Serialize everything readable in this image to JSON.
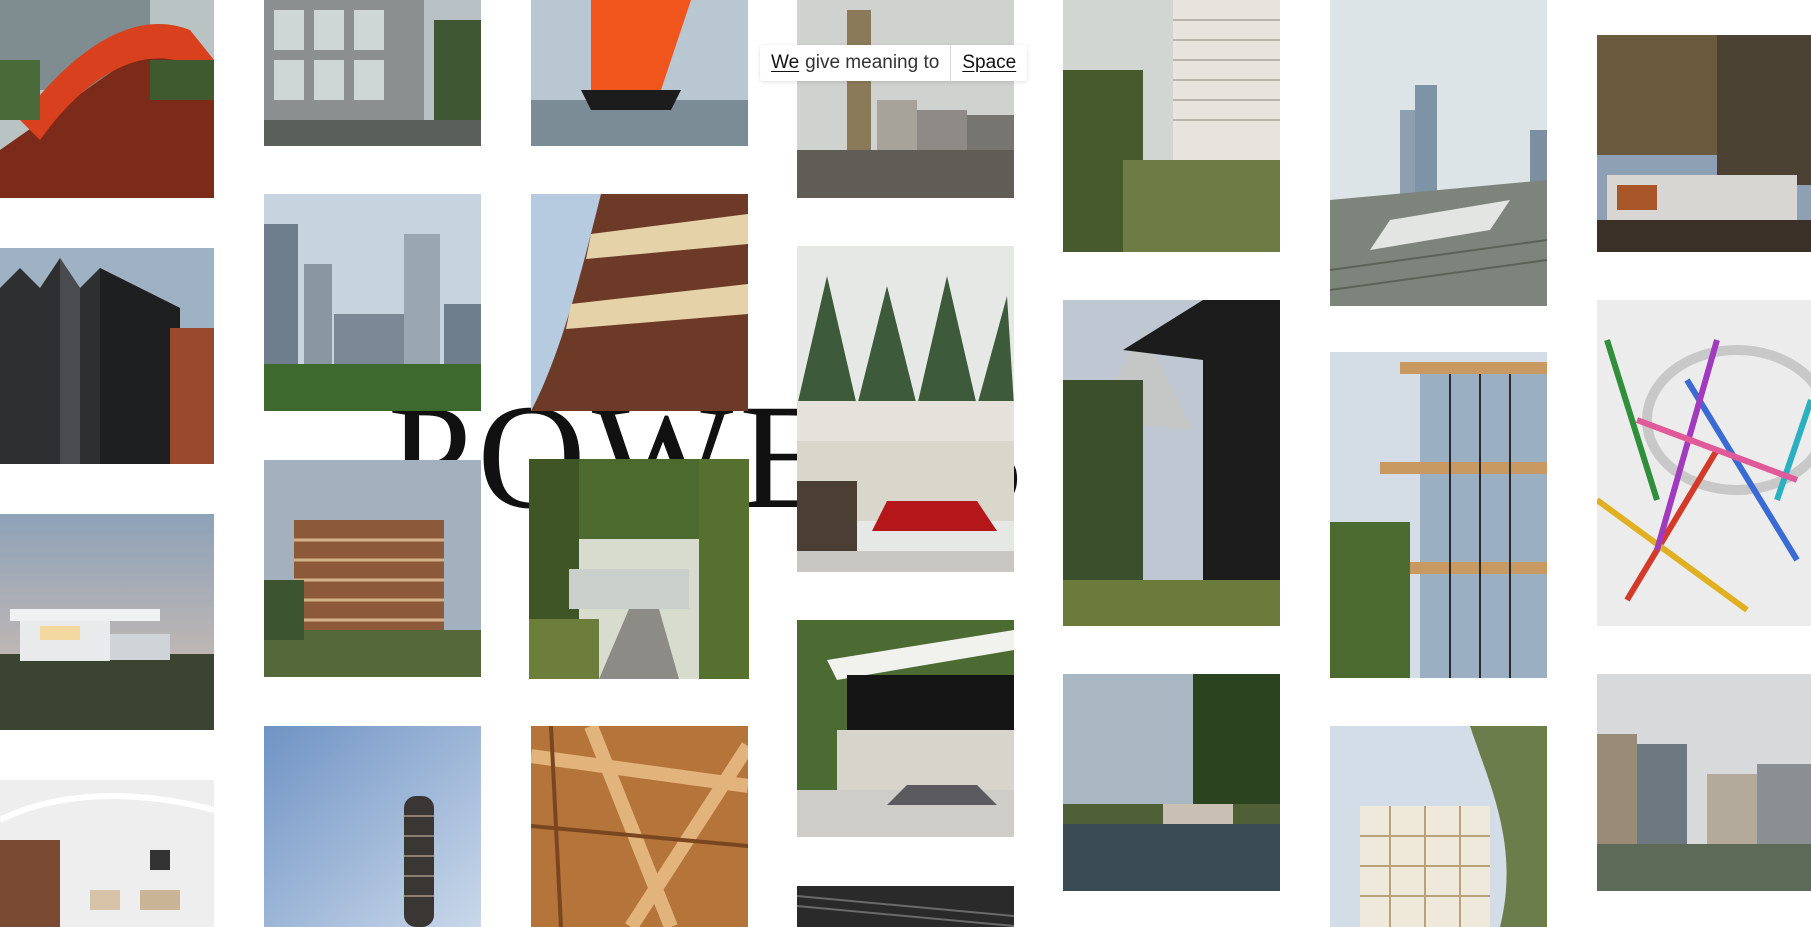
{
  "brand": {
    "wordmark": "POWERS CS",
    "tagline_we": "We",
    "tagline_rest": "give meaning to",
    "tagline_link": "Space"
  },
  "gallery": [
    {
      "id": "t1",
      "subject": "red-bridge-walkway"
    },
    {
      "id": "t2",
      "subject": "glass-office-facade"
    },
    {
      "id": "t3",
      "subject": "orange-sailboat"
    },
    {
      "id": "t4",
      "subject": "waterfront-skyline-tower"
    },
    {
      "id": "t5",
      "subject": "tower-with-forest"
    },
    {
      "id": "t6",
      "subject": "city-towers-railway"
    },
    {
      "id": "t7",
      "subject": "pavilion-in-woods"
    },
    {
      "id": "t8",
      "subject": "dark-metal-building"
    },
    {
      "id": "t9",
      "subject": "urban-towers-park"
    },
    {
      "id": "t10",
      "subject": "brick-banded-building"
    },
    {
      "id": "t11",
      "subject": "modern-house-red-car"
    },
    {
      "id": "t12",
      "subject": "black-timber-house-mountains"
    },
    {
      "id": "t13",
      "subject": "glass-building-balconies"
    },
    {
      "id": "t14",
      "subject": "colorful-art-installation"
    },
    {
      "id": "t15",
      "subject": "white-villa-dusk"
    },
    {
      "id": "t16",
      "subject": "timber-apartment-block"
    },
    {
      "id": "t17",
      "subject": "villa-tree-lane"
    },
    {
      "id": "t18",
      "subject": "house-with-convertible"
    },
    {
      "id": "t19",
      "subject": "lakeside-house"
    },
    {
      "id": "t20",
      "subject": "white-apartment-trees"
    },
    {
      "id": "t21",
      "subject": "waterfront-blocks"
    },
    {
      "id": "t22",
      "subject": "white-lounge-interior"
    },
    {
      "id": "t23",
      "subject": "slim-residential-tower"
    },
    {
      "id": "t24",
      "subject": "timber-roof-structure"
    },
    {
      "id": "t25",
      "subject": "dark-ceiling-interior"
    }
  ]
}
